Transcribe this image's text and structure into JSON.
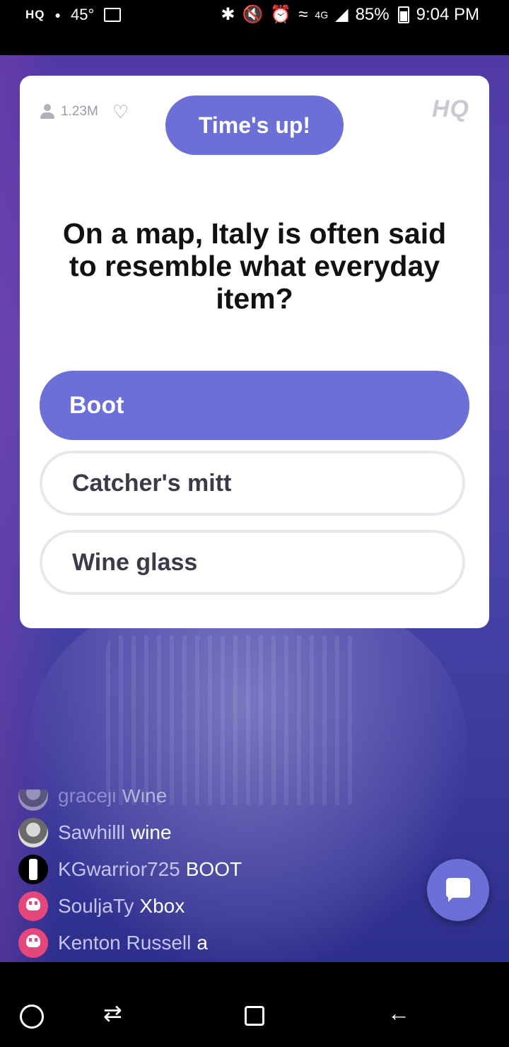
{
  "status_bar": {
    "app_badge": "HQ",
    "temperature": "45°",
    "network": "4G",
    "battery": "85%",
    "time": "9:04 PM"
  },
  "card": {
    "viewer_count": "1.23M",
    "logo": "HQ",
    "timer_text": "Time's up!",
    "question": "On a map, Italy is often said to resemble what everyday item?",
    "answers": [
      {
        "label": "Boot",
        "state": "selected"
      },
      {
        "label": "Catcher's mitt",
        "state": "default"
      },
      {
        "label": "Wine glass",
        "state": "default"
      }
    ]
  },
  "chat": {
    "messages": [
      {
        "user": "graceji",
        "text": "Wine"
      },
      {
        "user": "Sawhilll",
        "text": "wine"
      },
      {
        "user": "KGwarrior725",
        "text": "BOOT"
      },
      {
        "user": "SouljaTy",
        "text": "Xbox"
      },
      {
        "user": "Kenton Russell",
        "text": "a"
      }
    ]
  },
  "colors": {
    "accent": "#6b6fd6",
    "chat_username": "#c7c3f3",
    "skull_avatar": "#e6477a"
  }
}
